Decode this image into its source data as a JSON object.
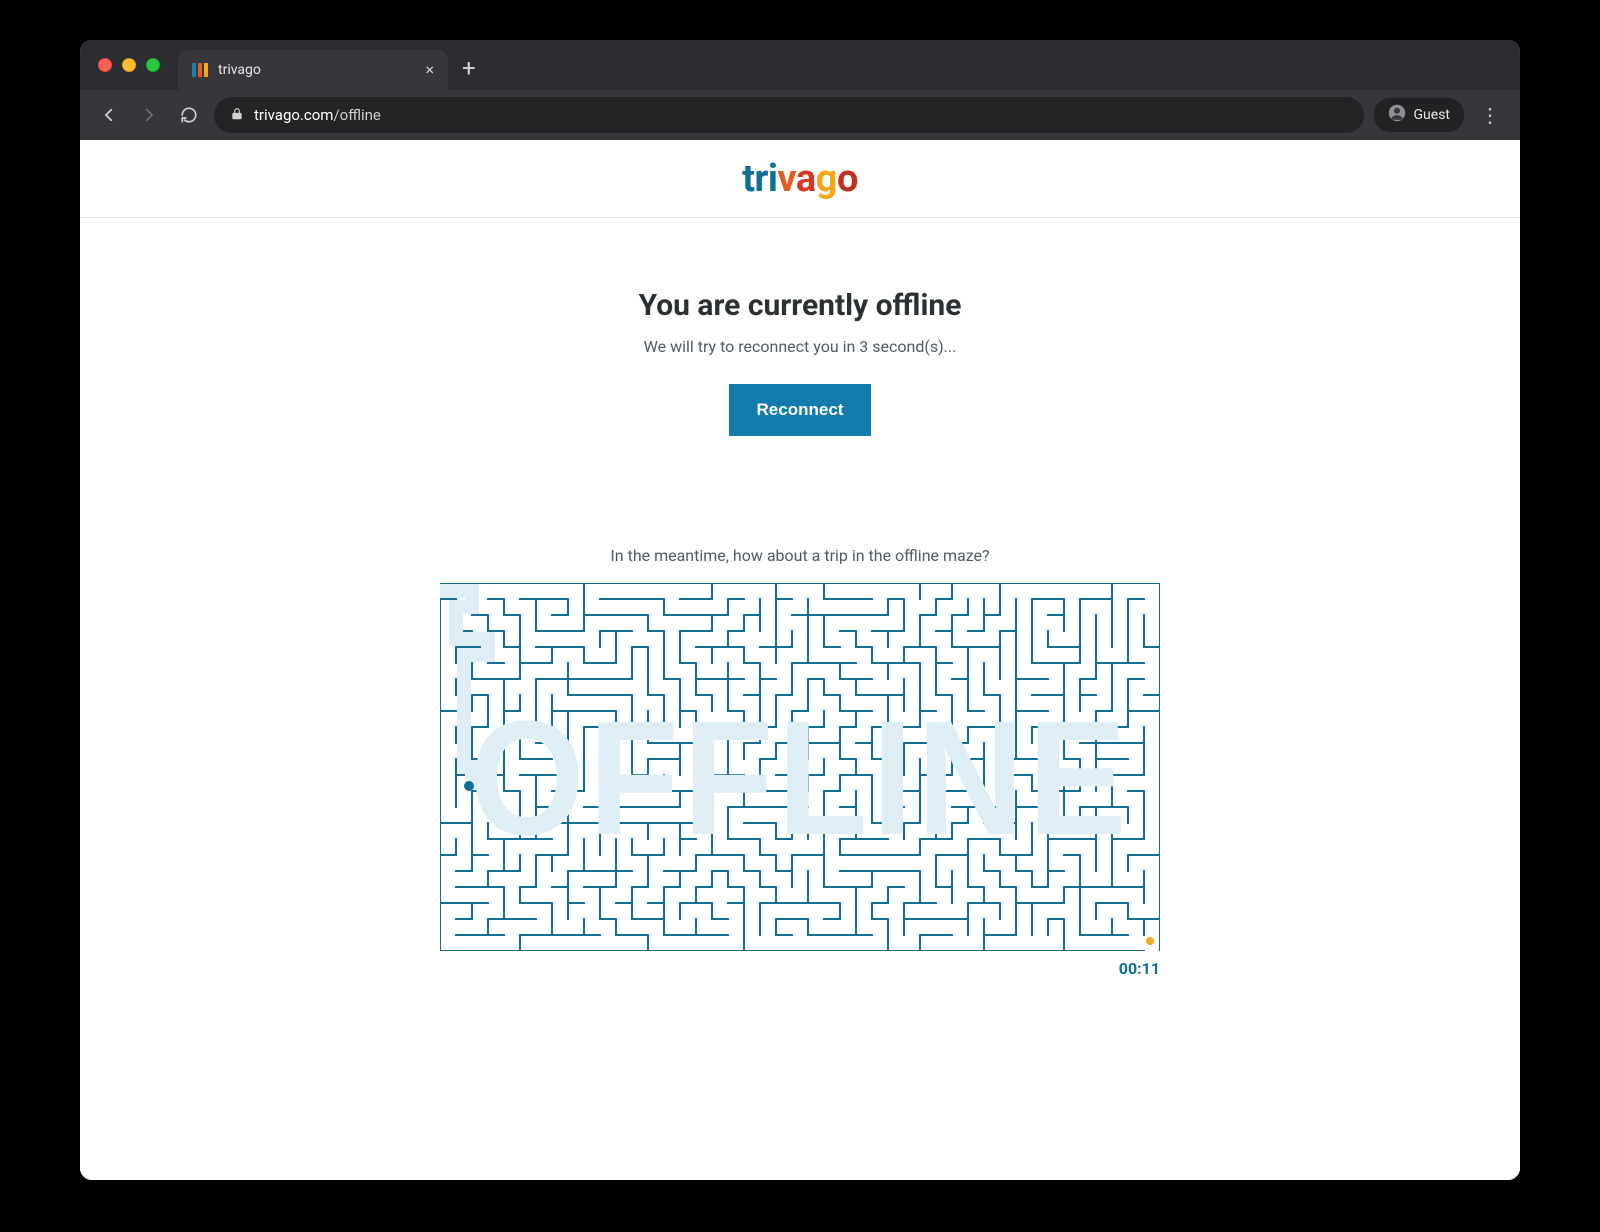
{
  "browser": {
    "tab_title": "trivago",
    "url_host": "trivago.com",
    "url_path": "/offline",
    "guest_label": "Guest"
  },
  "brand": {
    "letters": [
      "t",
      "r",
      "i",
      "v",
      "a",
      "g",
      "o"
    ]
  },
  "page": {
    "heading": "You are currently offline",
    "subtext": "We will try to reconnect you in 3 second(s)...",
    "reconnect_label": "Reconnect",
    "maze_intro": "In the meantime, how about a trip in the offline maze?",
    "maze_word": "OFFLINE",
    "timer": "00:11"
  },
  "colors": {
    "brand_blue": "#0f6f95",
    "brand_orange": "#e65a1d",
    "brand_red": "#d33826",
    "brand_yellow": "#f1a81d",
    "button_blue": "#127cad",
    "trail_light": "#dfeef5"
  }
}
